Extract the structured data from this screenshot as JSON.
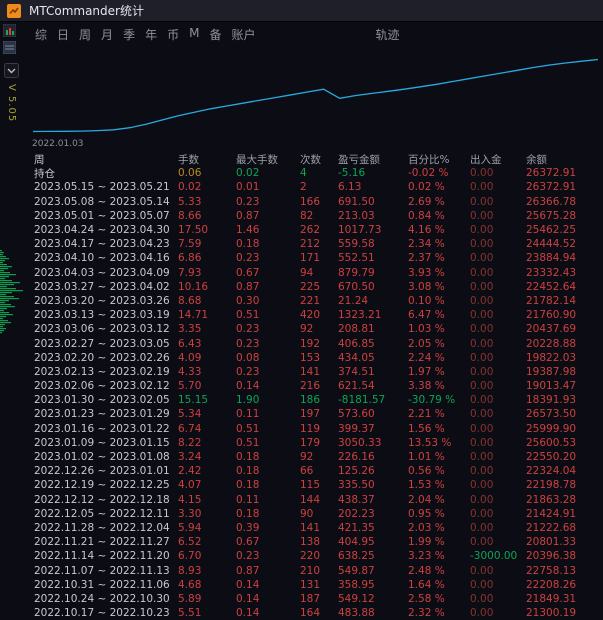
{
  "titlebar": {
    "title": "MTCommander统计"
  },
  "menubar": {
    "items": [
      "综",
      "日",
      "周",
      "月",
      "季",
      "年",
      "币",
      "M",
      "备",
      "账户"
    ],
    "right_item": "轨迹"
  },
  "left": {
    "version": "V 5.05",
    "histogram": [
      2,
      4,
      3,
      6,
      9,
      5,
      3,
      7,
      12,
      8,
      4,
      10,
      16,
      9,
      5,
      12,
      20,
      14,
      7,
      16,
      23,
      12,
      6,
      14,
      19,
      9,
      5,
      11,
      15,
      7,
      4,
      9,
      13,
      6,
      3,
      8,
      11,
      5,
      3,
      6,
      4,
      2
    ]
  },
  "chart": {
    "start_date": "2022.01.03"
  },
  "chart_data": {
    "type": "line",
    "title": "",
    "x_start": "2022.01.03",
    "series": [
      {
        "name": "余额",
        "values": [
          16350,
          16370,
          16390,
          16420,
          16480,
          16600,
          16900,
          17400,
          18000,
          18600,
          19100,
          19600,
          20000,
          20400,
          20800,
          21200,
          21600,
          22000,
          22400,
          21100,
          21500,
          21800,
          22100,
          22400,
          22750,
          23100,
          23500,
          23900,
          24300,
          24700,
          25100,
          25500,
          25850,
          26150,
          26400,
          26650
        ]
      }
    ],
    "ylim": [
      16000,
      27000
    ],
    "line_color": "#2aa9e1",
    "grid": false,
    "legend": false
  },
  "table": {
    "header": {
      "period": "周",
      "cols": [
        "手数",
        "最大手数",
        "次数",
        "盈亏金额",
        "百分比%",
        "出入金",
        "余额"
      ],
      "col_keys": [
        "lots",
        "max-lots",
        "count",
        "pnl",
        "percent",
        "cashflow",
        "balance"
      ]
    },
    "default_colors": [
      "r",
      "r",
      "r",
      "r",
      "r",
      "d",
      "r"
    ],
    "rows": [
      {
        "period": "持仓",
        "vals": [
          "0.06",
          "0.02",
          "4",
          "-5.16",
          "-0.02 %",
          "0.00",
          "26372.91"
        ],
        "colors": [
          "y",
          "g",
          "g",
          "g",
          "r",
          "d",
          "r"
        ]
      },
      {
        "period": "2023.05.15 ~ 2023.05.21",
        "vals": [
          "0.02",
          "0.01",
          "2",
          "6.13",
          "0.02 %",
          "0.00",
          "26372.91"
        ]
      },
      {
        "period": "2023.05.08 ~ 2023.05.14",
        "vals": [
          "5.33",
          "0.23",
          "166",
          "691.50",
          "2.69 %",
          "0.00",
          "26366.78"
        ]
      },
      {
        "period": "2023.05.01 ~ 2023.05.07",
        "vals": [
          "8.66",
          "0.87",
          "82",
          "213.03",
          "0.84 %",
          "0.00",
          "25675.28"
        ]
      },
      {
        "period": "2023.04.24 ~ 2023.04.30",
        "vals": [
          "17.50",
          "1.46",
          "262",
          "1017.73",
          "4.16 %",
          "0.00",
          "25462.25"
        ]
      },
      {
        "period": "2023.04.17 ~ 2023.04.23",
        "vals": [
          "7.59",
          "0.18",
          "212",
          "559.58",
          "2.34 %",
          "0.00",
          "24444.52"
        ]
      },
      {
        "period": "2023.04.10 ~ 2023.04.16",
        "vals": [
          "6.86",
          "0.23",
          "171",
          "552.51",
          "2.37 %",
          "0.00",
          "23884.94"
        ]
      },
      {
        "period": "2023.04.03 ~ 2023.04.09",
        "vals": [
          "7.93",
          "0.67",
          "94",
          "879.79",
          "3.93 %",
          "0.00",
          "23332.43"
        ]
      },
      {
        "period": "2023.03.27 ~ 2023.04.02",
        "vals": [
          "10.16",
          "0.87",
          "225",
          "670.50",
          "3.08 %",
          "0.00",
          "22452.64"
        ]
      },
      {
        "period": "2023.03.20 ~ 2023.03.26",
        "vals": [
          "8.68",
          "0.30",
          "221",
          "21.24",
          "0.10 %",
          "0.00",
          "21782.14"
        ]
      },
      {
        "period": "2023.03.13 ~ 2023.03.19",
        "vals": [
          "14.71",
          "0.51",
          "420",
          "1323.21",
          "6.47 %",
          "0.00",
          "21760.90"
        ]
      },
      {
        "period": "2023.03.06 ~ 2023.03.12",
        "vals": [
          "3.35",
          "0.23",
          "92",
          "208.81",
          "1.03 %",
          "0.00",
          "20437.69"
        ]
      },
      {
        "period": "2023.02.27 ~ 2023.03.05",
        "vals": [
          "6.43",
          "0.23",
          "192",
          "406.85",
          "2.05 %",
          "0.00",
          "20228.88"
        ]
      },
      {
        "period": "2023.02.20 ~ 2023.02.26",
        "vals": [
          "4.09",
          "0.08",
          "153",
          "434.05",
          "2.24 %",
          "0.00",
          "19822.03"
        ]
      },
      {
        "period": "2023.02.13 ~ 2023.02.19",
        "vals": [
          "4.33",
          "0.23",
          "141",
          "374.51",
          "1.97 %",
          "0.00",
          "19387.98"
        ]
      },
      {
        "period": "2023.02.06 ~ 2023.02.12",
        "vals": [
          "5.70",
          "0.14",
          "216",
          "621.54",
          "3.38 %",
          "0.00",
          "19013.47"
        ]
      },
      {
        "period": "2023.01.30 ~ 2023.02.05",
        "vals": [
          "15.15",
          "1.90",
          "186",
          "-8181.57",
          "-30.79 %",
          "0.00",
          "18391.93"
        ],
        "colors": [
          "g",
          "g",
          "g",
          "g",
          "g",
          "d",
          "r"
        ]
      },
      {
        "period": "2023.01.23 ~ 2023.01.29",
        "vals": [
          "5.34",
          "0.11",
          "197",
          "573.60",
          "2.21 %",
          "0.00",
          "26573.50"
        ]
      },
      {
        "period": "2023.01.16 ~ 2023.01.22",
        "vals": [
          "6.74",
          "0.51",
          "119",
          "399.37",
          "1.56 %",
          "0.00",
          "25999.90"
        ]
      },
      {
        "period": "2023.01.09 ~ 2023.01.15",
        "vals": [
          "8.22",
          "0.51",
          "179",
          "3050.33",
          "13.53 %",
          "0.00",
          "25600.53"
        ]
      },
      {
        "period": "2023.01.02 ~ 2023.01.08",
        "vals": [
          "3.24",
          "0.18",
          "92",
          "226.16",
          "1.01 %",
          "0.00",
          "22550.20"
        ]
      },
      {
        "period": "2022.12.26 ~ 2023.01.01",
        "vals": [
          "2.42",
          "0.18",
          "66",
          "125.26",
          "0.56 %",
          "0.00",
          "22324.04"
        ]
      },
      {
        "period": "2022.12.19 ~ 2022.12.25",
        "vals": [
          "4.07",
          "0.18",
          "115",
          "335.50",
          "1.53 %",
          "0.00",
          "22198.78"
        ]
      },
      {
        "period": "2022.12.12 ~ 2022.12.18",
        "vals": [
          "4.15",
          "0.11",
          "144",
          "438.37",
          "2.04 %",
          "0.00",
          "21863.28"
        ]
      },
      {
        "period": "2022.12.05 ~ 2022.12.11",
        "vals": [
          "3.30",
          "0.18",
          "90",
          "202.23",
          "0.95 %",
          "0.00",
          "21424.91"
        ]
      },
      {
        "period": "2022.11.28 ~ 2022.12.04",
        "vals": [
          "5.94",
          "0.39",
          "141",
          "421.35",
          "2.03 %",
          "0.00",
          "21222.68"
        ]
      },
      {
        "period": "2022.11.21 ~ 2022.11.27",
        "vals": [
          "6.52",
          "0.67",
          "138",
          "404.95",
          "1.99 %",
          "0.00",
          "20801.33"
        ]
      },
      {
        "period": "2022.11.14 ~ 2022.11.20",
        "vals": [
          "6.70",
          "0.23",
          "220",
          "638.25",
          "3.23 %",
          "-3000.00",
          "20396.38"
        ],
        "colors": [
          "r",
          "r",
          "r",
          "r",
          "r",
          "g",
          "r"
        ]
      },
      {
        "period": "2022.11.07 ~ 2022.11.13",
        "vals": [
          "8.93",
          "0.87",
          "210",
          "549.87",
          "2.48 %",
          "0.00",
          "22758.13"
        ]
      },
      {
        "period": "2022.10.31 ~ 2022.11.06",
        "vals": [
          "4.68",
          "0.14",
          "131",
          "358.95",
          "1.64 %",
          "0.00",
          "22208.26"
        ]
      },
      {
        "period": "2022.10.24 ~ 2022.10.30",
        "vals": [
          "5.89",
          "0.14",
          "187",
          "549.12",
          "2.58 %",
          "0.00",
          "21849.31"
        ]
      },
      {
        "period": "2022.10.17 ~ 2022.10.23",
        "vals": [
          "5.51",
          "0.14",
          "164",
          "483.88",
          "2.32 %",
          "0.00",
          "21300.19"
        ]
      }
    ]
  },
  "colors": {
    "r": "#cd4040",
    "g": "#0fa356",
    "y": "#bb8a25",
    "d": "#84342f",
    "w": "#c6c9cf",
    "accent_line": "#2aa9e1",
    "histogram_green": "#0b9e4c",
    "titlebar_bg": "#1e1f29",
    "app_bg": "#0c0d14"
  }
}
